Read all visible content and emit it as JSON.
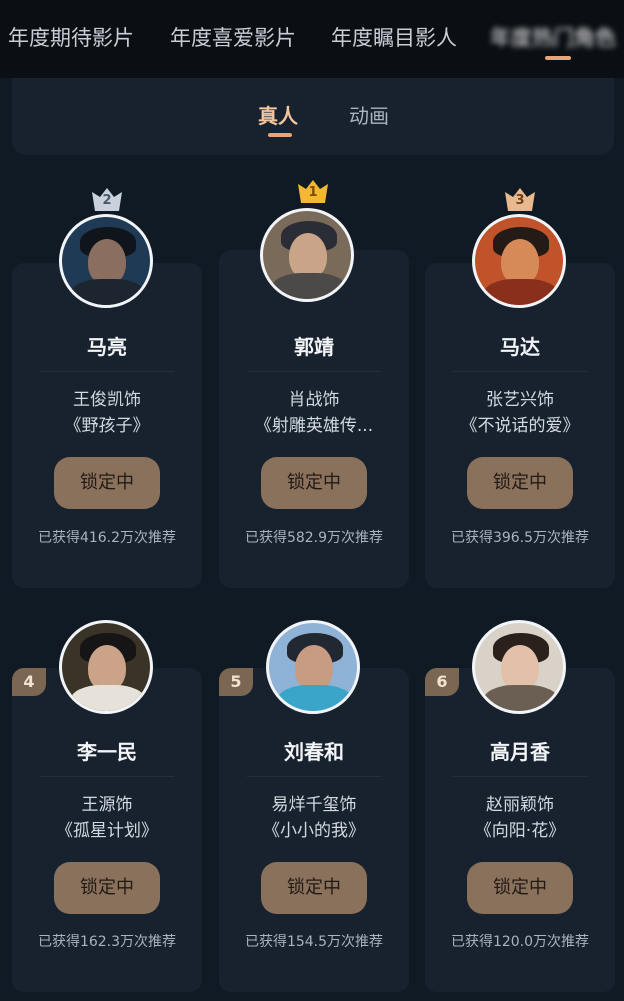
{
  "top_tabs": [
    "年度期待影片",
    "年度喜爱影片",
    "年度瞩目影人",
    "年度热门角色"
  ],
  "segment_tabs": [
    "真人",
    "动画"
  ],
  "accent_color": "#e9a375",
  "cards": [
    {
      "rank": "2",
      "name": "马亮",
      "actor": "王俊凯饰",
      "film": "《野孩子》",
      "button": "锁定中",
      "votes": "已获得416.2万次推荐"
    },
    {
      "rank": "1",
      "name": "郭靖",
      "actor": "肖战饰",
      "film": "《射雕英雄传...",
      "button": "锁定中",
      "votes": "已获得582.9万次推荐"
    },
    {
      "rank": "3",
      "name": "马达",
      "actor": "张艺兴饰",
      "film": "《不说话的爱》",
      "button": "锁定中",
      "votes": "已获得396.5万次推荐"
    },
    {
      "rank": "4",
      "name": "李一民",
      "actor": "王源饰",
      "film": "《孤星计划》",
      "button": "锁定中",
      "votes": "已获得162.3万次推荐"
    },
    {
      "rank": "5",
      "name": "刘春和",
      "actor": "易烊千玺饰",
      "film": "《小小的我》",
      "button": "锁定中",
      "votes": "已获得154.5万次推荐"
    },
    {
      "rank": "6",
      "name": "高月香",
      "actor": "赵丽颖饰",
      "film": "《向阳·花》",
      "button": "锁定中",
      "votes": "已获得120.0万次推荐"
    }
  ]
}
